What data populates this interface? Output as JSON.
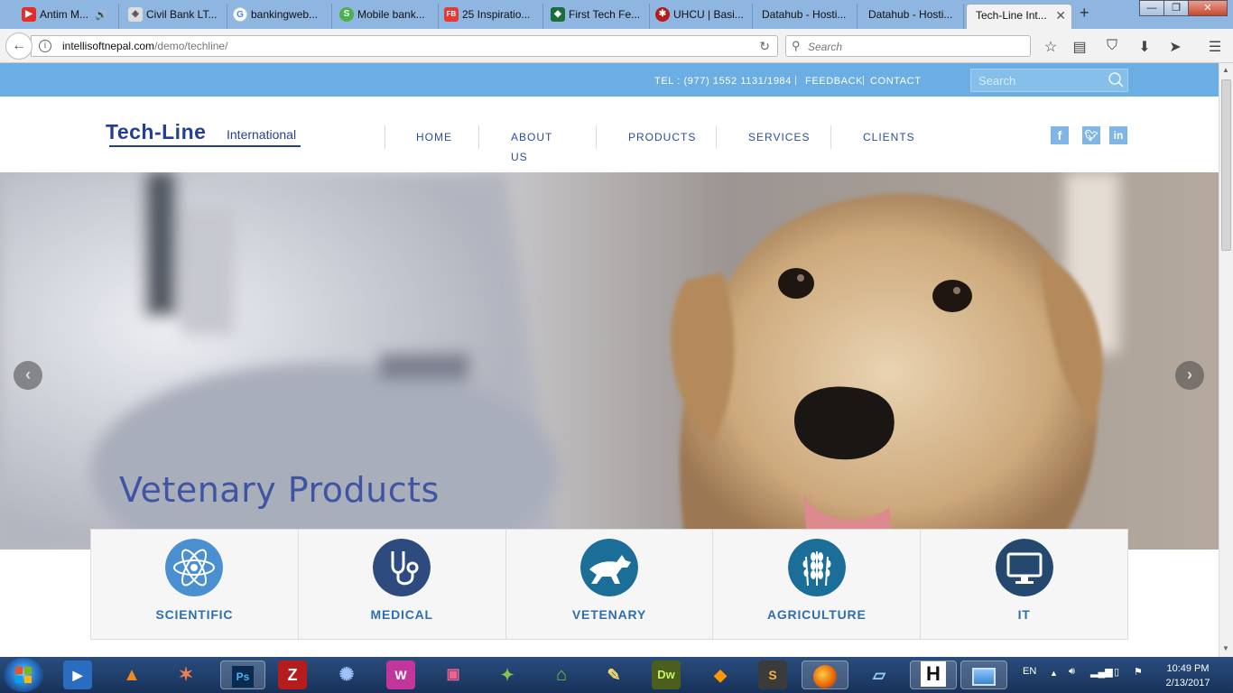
{
  "browser": {
    "tabs": [
      {
        "label": "Antim M...",
        "icon": "youtube-icon",
        "color": "#e52d27"
      },
      {
        "label": "Civil Bank LT...",
        "icon": "civil-bank-icon",
        "color": "#6b6b6b"
      },
      {
        "label": "bankingweb...",
        "icon": "google-icon",
        "color": "#4285f4"
      },
      {
        "label": "Mobile bank...",
        "icon": "mobile-bank-icon",
        "color": "#4caf50"
      },
      {
        "label": "25 Inspiratio...",
        "icon": "fb-icon",
        "color": "#e53935"
      },
      {
        "label": "First Tech Fe...",
        "icon": "first-tech-icon",
        "color": "#1b6e3a"
      },
      {
        "label": "UHCU | Basi...",
        "icon": "uhcu-icon",
        "color": "#b71c1c"
      },
      {
        "label": "Datahub - Hosti...",
        "icon": "",
        "color": ""
      },
      {
        "label": "Datahub - Hosti...",
        "icon": "",
        "color": ""
      },
      {
        "label": "Tech-Line Int...",
        "icon": "",
        "color": "",
        "active": true
      }
    ],
    "url_host": "intellisoftnepal.com",
    "url_path": "/demo/techline/",
    "search_placeholder": "Search"
  },
  "site": {
    "tel": "TEL : (977) 1552 1131/1984",
    "feedback": "FEEDBACK",
    "contact": "CONTACT",
    "search_placeholder": "Search",
    "logo_main": "Tech-Line",
    "logo_sub": "International",
    "nav": [
      "HOME",
      "ABOUT US",
      "PRODUCTS",
      "SERVICES",
      "CLIENTS"
    ],
    "social": [
      "facebook-icon",
      "twitter-icon",
      "linkedin-icon"
    ],
    "hero_title": "Vetenary Products",
    "categories": [
      {
        "label": "SCIENTIFIC",
        "icon": "atom-icon",
        "color": "#4a8fd0"
      },
      {
        "label": "MEDICAL",
        "icon": "stethoscope-icon",
        "color": "#2d4b7e"
      },
      {
        "label": "VETENARY",
        "icon": "dog-icon",
        "color": "#1a6e98"
      },
      {
        "label": "AGRICULTURE",
        "icon": "wheat-icon",
        "color": "#1a6e98"
      },
      {
        "label": "IT",
        "icon": "monitor-icon",
        "color": "#25496e"
      }
    ]
  },
  "taskbar": {
    "lang": "EN",
    "time": "10:49 PM",
    "date": "2/13/2017"
  }
}
